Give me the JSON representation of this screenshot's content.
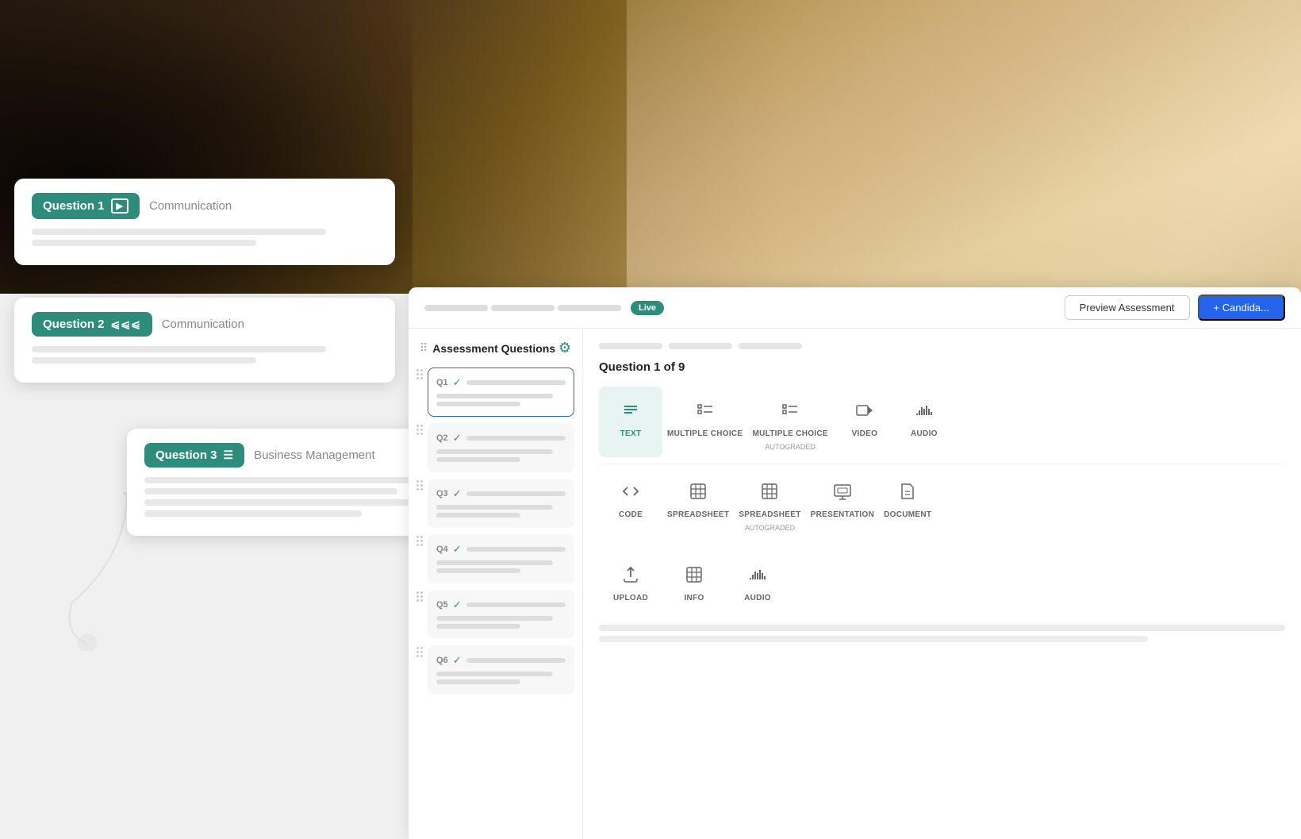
{
  "background": {
    "color": "#1a1a1a"
  },
  "questions": {
    "card1": {
      "badge": "Question 1",
      "icon": "▶",
      "category": "Communication",
      "line1_width": "85%",
      "line2_width": "65%"
    },
    "card2": {
      "badge": "Question 2",
      "icon": "|||",
      "category": "Communication",
      "line1_width": "85%",
      "line2_width": "65%"
    },
    "card3": {
      "badge": "Question 3",
      "icon": "☰",
      "category": "Business Management",
      "line1_width": "85%",
      "line2_width": "70%",
      "line3_width": "80%",
      "line4_width": "60%"
    }
  },
  "header": {
    "live_label": "Live",
    "preview_btn": "Preview Assessment",
    "candidate_btn": "+ Candida..."
  },
  "sidebar": {
    "title": "Assessment Questions",
    "items": [
      {
        "num": "Q1",
        "active": true
      },
      {
        "num": "Q2",
        "active": false
      },
      {
        "num": "Q3",
        "active": false
      },
      {
        "num": "Q4",
        "active": false
      },
      {
        "num": "Q5",
        "active": false
      },
      {
        "num": "Q6",
        "active": false
      }
    ]
  },
  "content": {
    "question_label": "Question 1 of 9",
    "types": [
      {
        "id": "text",
        "icon": "≡",
        "label": "TEXT",
        "sublabel": "",
        "active": true
      },
      {
        "id": "multiple-choice",
        "icon": ":=",
        "label": "MULTIPLE CHOICE",
        "sublabel": "",
        "active": false
      },
      {
        "id": "multiple-choice-auto",
        "icon": ":=",
        "label": "MULTIPLE CHOICE",
        "sublabel": "AUTOGRADED",
        "active": false
      },
      {
        "id": "video",
        "icon": "▶",
        "label": "VIDEO",
        "sublabel": "",
        "active": false
      },
      {
        "id": "audio",
        "icon": "|||",
        "label": "AUDIO",
        "sublabel": "",
        "active": false
      },
      {
        "id": "code",
        "icon": "</>",
        "label": "CODE",
        "sublabel": "",
        "active": false
      },
      {
        "id": "spreadsheet",
        "icon": "⊞",
        "label": "SPREADSHEET",
        "sublabel": "",
        "active": false
      },
      {
        "id": "spreadsheet-auto",
        "icon": "⊞",
        "label": "SPREADSHEET",
        "sublabel": "AUTOGRADED",
        "active": false
      },
      {
        "id": "presentation",
        "icon": "⊡",
        "label": "PRESENTATION",
        "sublabel": "",
        "active": false
      },
      {
        "id": "document",
        "icon": "⊟",
        "label": "DOCUMENT",
        "sublabel": "",
        "active": false
      },
      {
        "id": "upload",
        "icon": "↑",
        "label": "UPLOAD",
        "sublabel": "",
        "active": false
      },
      {
        "id": "info",
        "icon": "⊞",
        "label": "INFO",
        "sublabel": "",
        "active": false
      },
      {
        "id": "audio2",
        "icon": "|||",
        "label": "AUDIO",
        "sublabel": "",
        "active": false
      }
    ]
  },
  "colors": {
    "teal": "#2d8c7a",
    "blue": "#2563eb",
    "gray_bg": "#f7f7f7",
    "border": "#e5e5e5"
  }
}
